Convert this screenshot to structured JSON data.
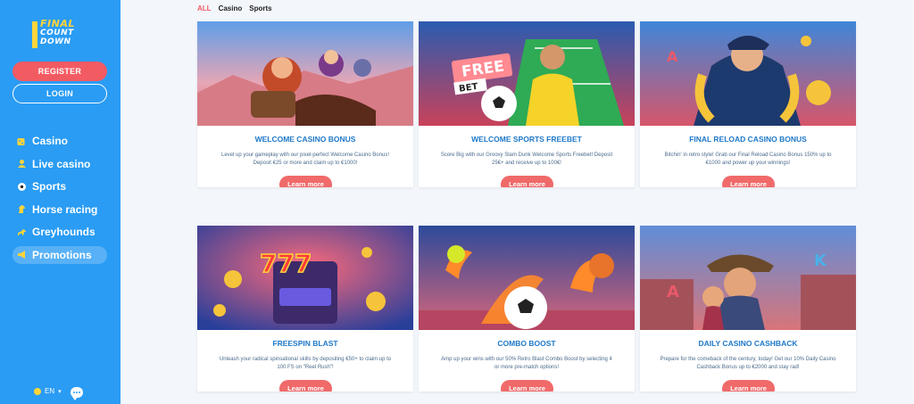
{
  "brand": {
    "logo_line1": "FINAL",
    "logo_line2": "COUNT",
    "logo_line3": "DOWN"
  },
  "auth": {
    "register_label": "REGISTER",
    "login_label": "LOGIN"
  },
  "nav": {
    "items": [
      {
        "label": "Casino",
        "icon": "dice-icon"
      },
      {
        "label": "Live casino",
        "icon": "dealer-icon"
      },
      {
        "label": "Sports",
        "icon": "soccer-ball-icon"
      },
      {
        "label": "Horse racing",
        "icon": "horse-icon"
      },
      {
        "label": "Greyhounds",
        "icon": "dog-icon"
      },
      {
        "label": "Promotions",
        "icon": "megaphone-icon",
        "active": true
      }
    ]
  },
  "footer": {
    "language": "EN"
  },
  "tabs": [
    {
      "label": "ALL",
      "active": true
    },
    {
      "label": "Casino"
    },
    {
      "label": "Sports"
    }
  ],
  "promotions": [
    {
      "title": "WELCOME CASINO BONUS",
      "description": "Level up your gameplay with our pixel-perfect Welcome Casino Bonus! Deposit €25 or more and claim up to €1000!",
      "button": "Learn more",
      "art": "fantasy-heroes"
    },
    {
      "title": "WELCOME SPORTS FREEBET",
      "description": "Score Big with our Groovy Slam Dunk Welcome Sports Freebet! Deposit 25€+ and receive up to 100€!",
      "button": "Learn more",
      "art": "free-bet",
      "art_text_1": "FREE",
      "art_text_2": "BET"
    },
    {
      "title": "FINAL RELOAD CASINO BONUS",
      "description": "Bitchin' in retro style! Grab our Final Reload Casino Bonus 150% up to €1000 and power up your winnings!",
      "button": "Learn more",
      "art": "pirate-captain"
    },
    {
      "title": "FREESPIN BLAST",
      "description": "Unleash your radical spinsational skills by depositing €50+ to claim up to 100 FS on \"Reel Rush\"!",
      "button": "Learn more",
      "art": "slot-machine",
      "art_text_1": "777"
    },
    {
      "title": "COMBO BOOST",
      "description": "Amp up your wins with our 50% Retro Blast Combo Boost by selecting 4 or more pre-match options!",
      "button": "Learn more",
      "art": "flaming-balls"
    },
    {
      "title": "DAILY CASINO CASHBACK",
      "description": "Prepare for the comeback of the century, today! Get our 10% Daily Casino Cashback Bonus up to €2000 and stay rad!",
      "button": "Learn more",
      "art": "cowboys"
    }
  ],
  "colors": {
    "sidebar": "#2a9cf4",
    "accent": "#f35b63",
    "title": "#1e78c8"
  }
}
